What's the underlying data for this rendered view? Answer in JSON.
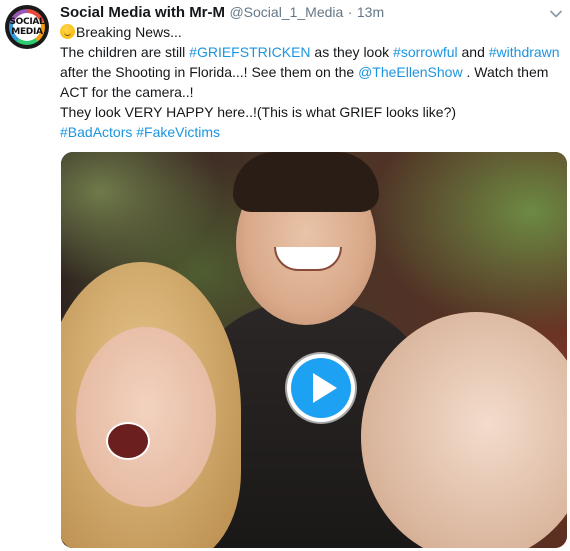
{
  "author": {
    "avatar_text_line1": "SOCIAL",
    "avatar_text_line2": "MEDIA",
    "name": "Social Media with Mr-M",
    "handle": "@Social_1_Media",
    "separator": "·",
    "time": "13m"
  },
  "tweet": {
    "line1": {
      "emoji": "smirk-emoji",
      "text": "Breaking News..."
    },
    "line2": {
      "t1": "The children are still ",
      "tag1": "#GRIEFSTRICKEN",
      "t2": " as they look ",
      "tag2": "#sorrowful",
      "t3": " and ",
      "tag3": "#withdrawn"
    },
    "line3": {
      "t1": "after the Shooting in Florida...! See them on the ",
      "mention": "@TheEllenShow",
      "t2": " . Watch them"
    },
    "line4": {
      "t1": "ACT for the camera..!"
    },
    "line5": {
      "t1": "They look VERY HAPPY here..!(This is what GRIEF looks like?)"
    },
    "line6": {
      "tag1": "#BadActors",
      "tag2": "#FakeVictims"
    }
  },
  "media": {
    "type": "video",
    "play_icon": "play-icon"
  },
  "colors": {
    "link": "#1b95e0",
    "text": "#14171a",
    "meta": "#657786",
    "play": "#1da1f2"
  }
}
